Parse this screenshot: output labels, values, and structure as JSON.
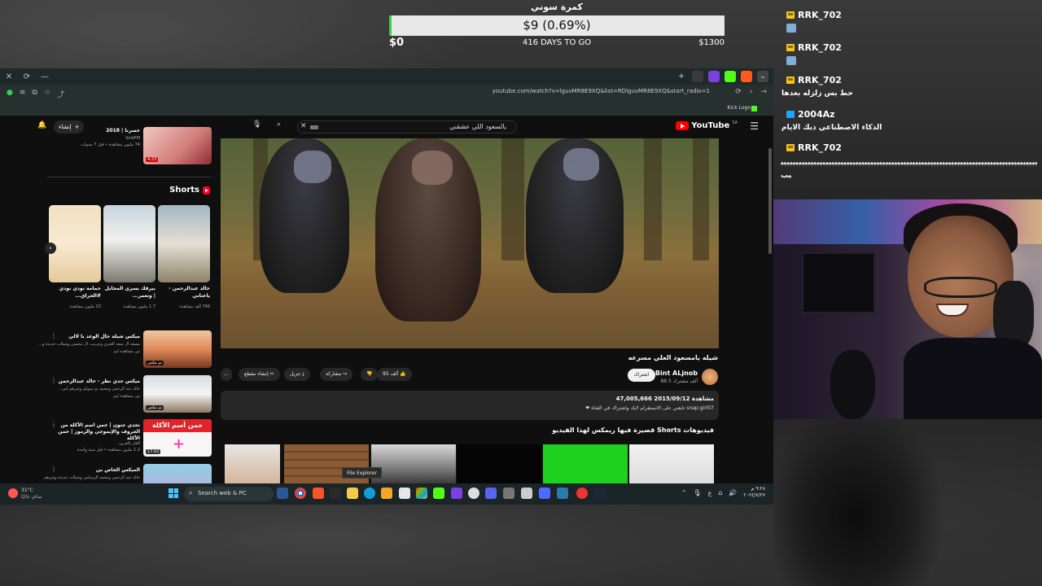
{
  "goal": {
    "title": "كمرة سوني",
    "amount_label": "$9 (0.69%)",
    "progress_percent": 0.69,
    "start": "$0",
    "days_left": "416 DAYS TO GO",
    "target": "$1300",
    "fill_color": "#3ccf4e"
  },
  "browser": {
    "url": "youtube.com/watch?v=lguvMR8E9XQ&list=RDlguvMR8E9XQ&start_radio=1",
    "bookmark_kick": "Kick Logo",
    "controls": {
      "close": "✕",
      "refresh": "⟳",
      "minimize": "—"
    }
  },
  "youtube": {
    "logo_text": "YouTube",
    "country": "SA",
    "search_query": "يالسعود اللي عشقني",
    "create_label": "إنشاء",
    "video_title": "شيله يامسعود العلي مسرعه",
    "channel_name": "Bint ALjnob",
    "channel_subs": "88.5 ألف مشترك",
    "subscribe_label": "اشتراك",
    "likes": "95 ألف",
    "share_label": "مشاركة",
    "download_label": "تنزيل",
    "clip_label": "إنشاء مقطع",
    "more_label": "...",
    "description_stats": "47,005,666 مشاهدة  2015/09/12",
    "description_text": "snap:girl07 تابعني على الانستقرام لايك واشتراك في القناة ❤",
    "remix_title": "فيديوهات Shorts قصيرة فيها ريمكس لهذا الفيديو",
    "top_item": {
      "title": "خسرنا | 2018",
      "channel": "SoloFM",
      "meta": "74 مليون مشاهدة • قبل 7 سنوات",
      "duration": "4:23"
    },
    "shorts_header": "Shorts",
    "shorts": [
      {
        "title": "خالد عبدالرحمن - ياعناني",
        "views": "746 ألف مشاهدة"
      },
      {
        "title": "بيرقك يسري المخايل | وتعمر...",
        "views": "1.7 مليون مشاهدة"
      },
      {
        "title": "حمامة نودي نودي #الحراق...",
        "views": "23 مليون مشاهدة"
      }
    ],
    "list_items": [
      {
        "title": "ميكس شيلة حال الوعد يا لالي",
        "sub": "مسعد ال سعد العنزي وعريب، ال محسن وشيلات جديدة و...",
        "sub2": "من مشاهدة ليم",
        "badge": "تم مكس"
      },
      {
        "title": "ميكس حدي نطر - خالد عبدالرحمن",
        "sub": "خالد عبد الرحمن ومحمد بو سويلم وغيرهم ليم...",
        "sub2": "من مشاهدة ليم",
        "badge": "تم مكس"
      },
      {
        "title": "تحدي جنون | خمن اسم الأكلة من الحروف والإيموجي والرموز | خمن الأكلة",
        "sub": "ألغاز بالعربي",
        "sub2": "1.2 مليون مشاهدة • قبل سنة واحدة",
        "duration": "17:02",
        "thumb_text": "خمن أسم الأكلة"
      },
      {
        "title": "الميكس الخاص بي",
        "sub": "خالد عبد الرحمن ومحمد الرسامي وشيلات جديدة وغيرهم",
        "sub2": ""
      }
    ]
  },
  "taskbar": {
    "weather_temp": "31°C",
    "weather_cond": "صافٍ غالبًا",
    "search_label": "Search web & PC",
    "tooltip": "File Explorer",
    "clock_time": "٩:٢٨ م",
    "clock_date": "٢٠٢٤/٧/٢٧",
    "tray_lang": "ع"
  },
  "chat": [
    {
      "user": "RRK_702",
      "badge": "gold",
      "message": ""
    },
    {
      "user": "RRK_702",
      "badge": "gold",
      "message": ""
    },
    {
      "user": "RRK_702",
      "badge": "gold",
      "message": "حط بس زلزله بعدها"
    },
    {
      "user": "2004Az",
      "badge": "blue",
      "message": "الذكاء الاصطناعي ذبك الايام"
    },
    {
      "user": "RRK_702",
      "badge": "gold",
      "message": "بببببببببببببببببببببببببببببببببببببببببببببببببببببببببببببببببببببببببببببببببببببببب"
    }
  ]
}
